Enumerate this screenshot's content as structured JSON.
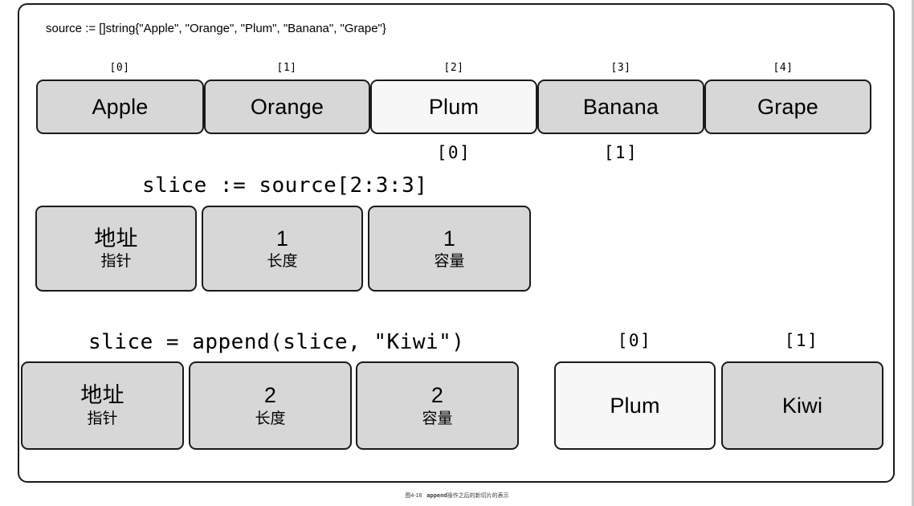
{
  "figure": {
    "source_declaration": "source := []string{\"Apple\", \"Orange\", \"Plum\", \"Banana\", \"Grape\"}",
    "slice_declaration": "slice := source[2:3:3]",
    "append_statement": "slice = append(slice, \"Kiwi\")",
    "caption_prefix": "图4-18",
    "caption_code": "append",
    "caption_suffix": "操作之后的新切片的表示"
  },
  "colors": {
    "box_fill": "#d7d7d7",
    "box_fill_highlight": "#f7f7f7",
    "box_border": "#1a1a1a",
    "frame_border": "#1a1a1a",
    "background": "#ffffff"
  },
  "source_array": {
    "indices": [
      "[0]",
      "[1]",
      "[2]",
      "[3]",
      "[4]"
    ],
    "values": [
      "Apple",
      "Orange",
      "Plum",
      "Banana",
      "Grape"
    ],
    "highlighted": [
      false,
      false,
      true,
      false,
      false
    ]
  },
  "slice_view_indices": {
    "label_0": "[0]",
    "label_1": "[1]"
  },
  "slice_header_before": {
    "fields": [
      {
        "main": "地址",
        "sub": "指针"
      },
      {
        "main": "1",
        "sub": "长度"
      },
      {
        "main": "1",
        "sub": "容量"
      }
    ]
  },
  "slice_header_after": {
    "fields": [
      {
        "main": "地址",
        "sub": "指针"
      },
      {
        "main": "2",
        "sub": "长度"
      },
      {
        "main": "2",
        "sub": "容量"
      }
    ]
  },
  "result_array": {
    "indices": [
      "[0]",
      "[1]"
    ],
    "values": [
      "Plum",
      "Kiwi"
    ],
    "highlighted": [
      true,
      false
    ]
  }
}
